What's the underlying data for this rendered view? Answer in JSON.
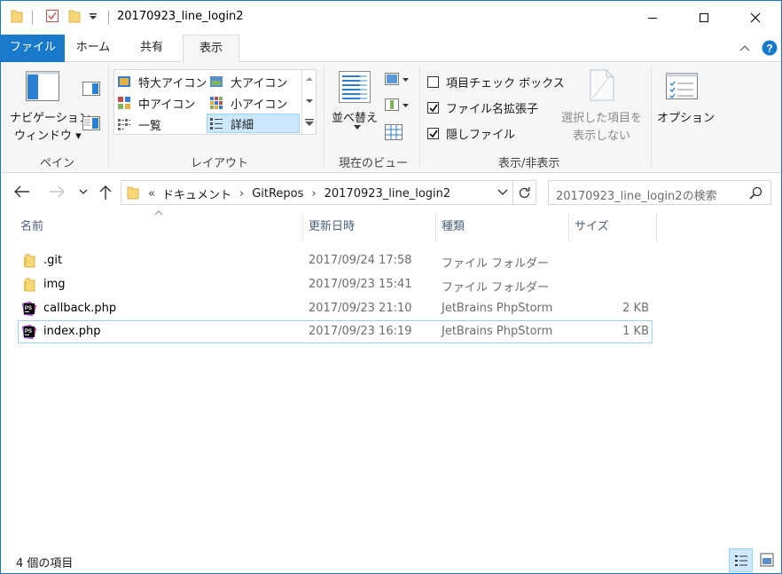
{
  "titlebar": {
    "title": "20170923_line_login2",
    "minimize_icon": "minimize-icon",
    "maximize_icon": "maximize-icon",
    "close_icon": "close-icon"
  },
  "tabs": [
    {
      "label": "ファイル"
    },
    {
      "label": "ホーム"
    },
    {
      "label": "共有"
    },
    {
      "label": "表示"
    }
  ],
  "ribbon": {
    "pane": {
      "nav_pane_line1": "ナビゲーション",
      "nav_pane_line2": "ウィンドウ",
      "group_label": "ペイン"
    },
    "layout": {
      "items": [
        {
          "label": "特大アイコン",
          "selected": false
        },
        {
          "label": "大アイコン",
          "selected": false
        },
        {
          "label": "中アイコン",
          "selected": false
        },
        {
          "label": "小アイコン",
          "selected": false
        },
        {
          "label": "一覧",
          "selected": false
        },
        {
          "label": "詳細",
          "selected": true
        }
      ],
      "group_label": "レイアウト"
    },
    "current_view": {
      "sort_label": "並べ替え",
      "group_label": "現在のビュー"
    },
    "show_hide": {
      "checkboxes": [
        {
          "label": "項目チェック ボックス",
          "checked": false
        },
        {
          "label": "ファイル名拡張子",
          "checked": true
        },
        {
          "label": "隠しファイル",
          "checked": true
        }
      ],
      "hide_selected_line1": "選択した項目を",
      "hide_selected_line2": "表示しない",
      "group_label": "表示/非表示"
    },
    "options_label": "オプション"
  },
  "nav": {
    "breadcrumb_prefix": "«",
    "crumbs": [
      "ドキュメント",
      "GitRepos",
      "20170923_line_login2"
    ],
    "search_placeholder": "20170923_line_login2の検索"
  },
  "columns": {
    "name": "名前",
    "date": "更新日時",
    "type": "種類",
    "size": "サイズ"
  },
  "files": [
    {
      "name": ".git",
      "date": "2017/09/24 17:58",
      "type": "ファイル フォルダー",
      "size": "",
      "icon": "folder-icon"
    },
    {
      "name": "img",
      "date": "2017/09/23 15:41",
      "type": "ファイル フォルダー",
      "size": "",
      "icon": "folder-icon"
    },
    {
      "name": "callback.php",
      "date": "2017/09/23 21:10",
      "type": "JetBrains PhpStorm",
      "size": "2 KB",
      "icon": "phpstorm-icon"
    },
    {
      "name": "index.php",
      "date": "2017/09/23 16:19",
      "type": "JetBrains PhpStorm",
      "size": "1 KB",
      "icon": "phpstorm-icon"
    }
  ],
  "status": {
    "item_count": "4 個の項目"
  },
  "colors": {
    "accent": "#1979ca",
    "selection": "#cce8ff",
    "folder": "#f8d775"
  }
}
